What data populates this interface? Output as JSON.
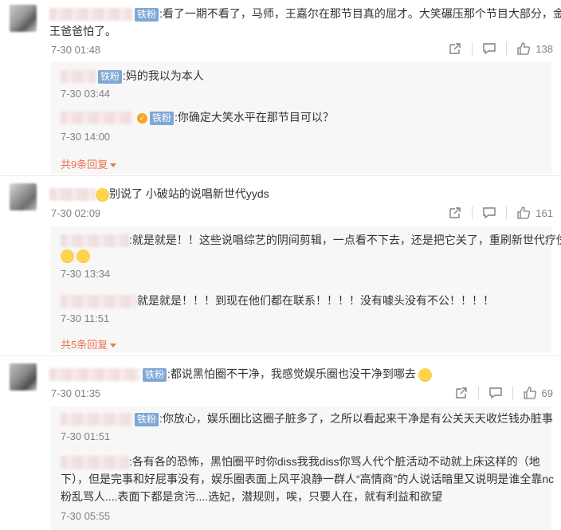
{
  "colors": {
    "badge": "#7ea7d6",
    "accent": "#eb7350",
    "time": "#808080"
  },
  "icons": {
    "share": "share-icon",
    "comment": "comment-icon",
    "like": "thumbs-up-icon"
  },
  "comments": [
    {
      "badge": "铁粉",
      "text_line1": ":看了一期不看了，马师，王嘉尔在那节目真的屈才。大笑碾压那个节目大部分，金",
      "text_line2": "王爸爸怕了。",
      "time": "7-30 01:48",
      "likes": "138",
      "replies": [
        {
          "badge": "铁粉",
          "text": ":妈的我以为本人",
          "time": "7-30 03:44"
        },
        {
          "badge": "铁粉",
          "text": ":你确定大笑水平在那节目可以？",
          "time": "7-30 14:00"
        }
      ],
      "more": "共9条回复"
    },
    {
      "text": "别说了 小破站的说唱新世代yyds",
      "time": "7-30 02:09",
      "likes": "161",
      "replies": [
        {
          "text": ":就是就是！！这些说唱综艺的阴间剪辑，一点看不下去，还是把它关了，重刷新世代疗伤",
          "time": "7-30 13:34"
        },
        {
          "text": "就是就是！！！到现在他们都在联系！！！！没有噱头没有不公！！！！",
          "time": "7-30 11:51"
        }
      ],
      "more": "共5条回复"
    },
    {
      "badge": "铁粉",
      "text": ":都说黑怕圈不干净，我感觉娱乐圈也没干净到哪去",
      "time": "7-30 01:35",
      "likes": "69",
      "replies": [
        {
          "badge": "铁粉",
          "text": ":你放心，娱乐圈比这圈子脏多了，之所以看起来干净是有公关天天收烂钱办脏事",
          "time": "7-30 01:51"
        },
        {
          "text_line1": ":各有各的恐怖，黑怕圈平时你diss我我diss你骂人代个脏活动不动就上床这样的（地",
          "text_line2": "下），但是完事和好屁事没有，娱乐圈表面上风平浪静一群人“高情商”的人说话暗里又说明是谁全靠nc",
          "text_line3": "粉乱骂人....表面下都是贪污....选妃，潜规则，唉，只要人在，就有利益和欲望",
          "time": "7-30 05:55"
        }
      ]
    }
  ]
}
